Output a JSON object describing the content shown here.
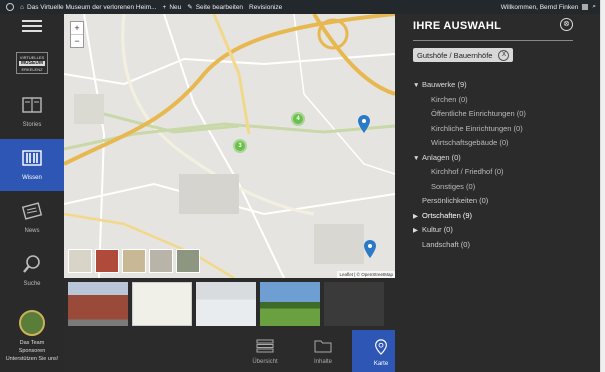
{
  "adminbar": {
    "site": "Das Virtuelle Museum der verlorenen Heim...",
    "new": "Neu",
    "edit": "Seite bearbeiten",
    "revisions": "Revisionize",
    "welcome": "Willkommen, Bernd Finken"
  },
  "sidebar": {
    "logo_top": "VIRTUELLES",
    "logo_mid": "MUSEUM",
    "logo_bottom": "ERKELENZ",
    "items": [
      {
        "label": "Stories",
        "icon": "book-icon"
      },
      {
        "label": "Wissen",
        "icon": "library-icon"
      },
      {
        "label": "News",
        "icon": "newspaper-icon"
      },
      {
        "label": "Suche",
        "icon": "search-icon"
      }
    ],
    "team_line1": "Das Team",
    "team_line2": "Sponsoren",
    "team_line3": "Unterstützen Sie uns!"
  },
  "map": {
    "zoom_in": "+",
    "zoom_out": "−",
    "attribution": "Leaflet | © OpenStreetMap",
    "clusters": [
      "4",
      "3"
    ]
  },
  "panel": {
    "title": "IHRE AUSWAHL",
    "close": "⊗",
    "filter_chip": "Gutshöfe / Bauernhöfe",
    "filter_remove": "X",
    "tree": [
      {
        "kind": "top",
        "arrow": "▼",
        "label": "Bauwerke",
        "count": "(9)"
      },
      {
        "kind": "sub",
        "label": "Kirchen (0)"
      },
      {
        "kind": "sub",
        "label": "Öffentliche Einrichtungen (0)"
      },
      {
        "kind": "sub",
        "label": "Kirchliche Einrichtungen (0)"
      },
      {
        "kind": "sub",
        "label": "Wirtschaftsgebäude (0)"
      },
      {
        "kind": "top",
        "arrow": "▼",
        "label": "Anlagen",
        "count": "(0)"
      },
      {
        "kind": "sub",
        "label": "Kirchhof / Friedhof (0)"
      },
      {
        "kind": "sub",
        "label": "Sonstiges (0)"
      },
      {
        "kind": "plain",
        "label": "Persönlichkeiten (0)"
      },
      {
        "kind": "top",
        "arrow": "▶",
        "label": "Ortschaften",
        "count": "(9)"
      },
      {
        "kind": "top",
        "arrow": "▶",
        "label": "Kultur",
        "count": "(0)"
      },
      {
        "kind": "plain",
        "label": "Landschaft (0)"
      }
    ]
  },
  "tabs": [
    {
      "label": "Übersicht",
      "icon": "list-icon"
    },
    {
      "label": "Inhalte",
      "icon": "folder-icon"
    },
    {
      "label": "Karte",
      "icon": "map-pin-icon"
    }
  ],
  "colors": {
    "accent": "#2e56b5",
    "dark": "#2b2b2b",
    "cluster": "#6bc04b",
    "pin": "#2a7ac7",
    "road": "#e8b850"
  }
}
